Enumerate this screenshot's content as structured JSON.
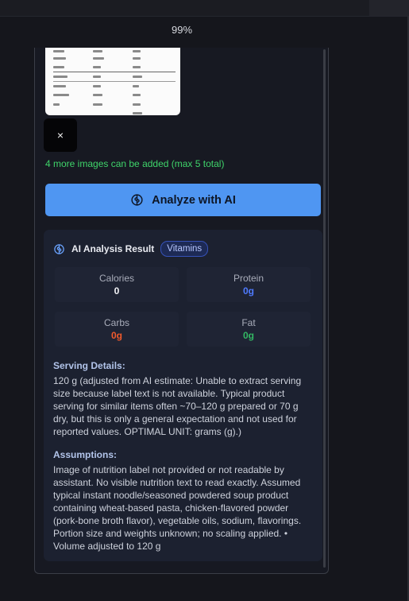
{
  "zoom": {
    "label": "99%"
  },
  "image_panel": {
    "remove_label": "×",
    "hint": "4 more images can be added (max 5 total)"
  },
  "analyze_button": {
    "label": "Analyze with AI",
    "icon": "brain-icon"
  },
  "result": {
    "title": "AI Analysis Result",
    "badge": "Vitamins",
    "icon": "brain-icon",
    "stats": {
      "calories": {
        "label": "Calories",
        "value": "0"
      },
      "protein": {
        "label": "Protein",
        "value": "0g"
      },
      "carbs": {
        "label": "Carbs",
        "value": "0g"
      },
      "fat": {
        "label": "Fat",
        "value": "0g"
      }
    },
    "serving_title": "Serving Details:",
    "serving_text": "120 g (adjusted from AI estimate: Unable to extract serving size because label text is not available. Typical product serving for similar items often ~70–120 g prepared or 70 g dry, but this is only a general expectation and not used for reported values. OPTIMAL UNIT: grams (g).)",
    "assumptions_title": "Assumptions:",
    "assumptions_text": "Image of nutrition label not provided or not readable by assistant. No visible nutrition text to read exactly. Assumed typical instant noodle/seasoned powdered soup product containing wheat-based pasta, chicken-flavored powder (pork-bone broth flavor), vegetable oils, sodium, flavorings. Portion size and weights unknown; no scaling applied. • Volume adjusted to 120 g"
  },
  "colors": {
    "accent": "#4f96f2",
    "success": "#3fd46a",
    "protein": "#4f7bff",
    "carbs": "#f05a2c",
    "fat": "#33b864"
  }
}
